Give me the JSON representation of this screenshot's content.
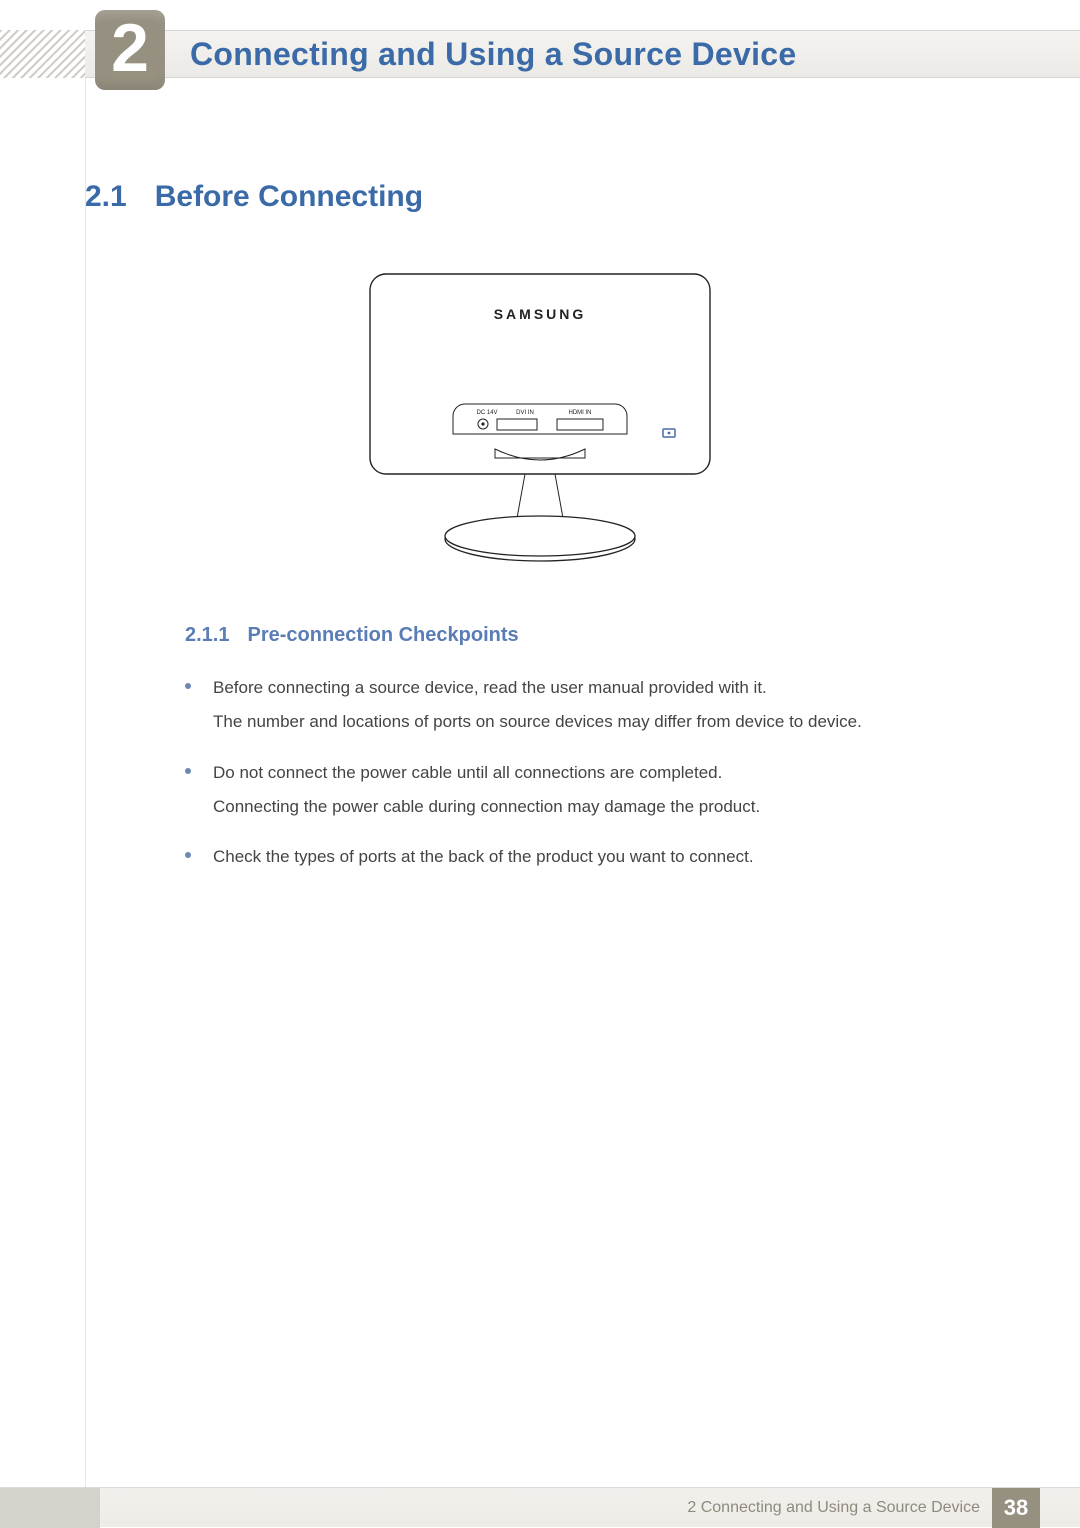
{
  "chapter": {
    "number": "2",
    "title": "Connecting and Using a Source Device"
  },
  "section": {
    "number": "2.1",
    "title": "Before Connecting"
  },
  "illustration": {
    "brand": "SAMSUNG",
    "ports": [
      "DC 14V",
      "DVI IN",
      "HDMI IN"
    ]
  },
  "subsection": {
    "number": "2.1.1",
    "title": "Pre-connection Checkpoints"
  },
  "bullets": [
    {
      "lines": [
        "Before connecting a source device, read the user manual provided with it.",
        "The number and locations of ports on source devices may differ from device to device."
      ]
    },
    {
      "lines": [
        "Do not connect the power cable until all connections are completed.",
        "Connecting the power cable during connection may damage the product."
      ]
    },
    {
      "lines": [
        "Check the types of ports at the back of the product you want to connect."
      ]
    }
  ],
  "footer": {
    "text": "2 Connecting and Using a Source Device",
    "page": "38"
  }
}
